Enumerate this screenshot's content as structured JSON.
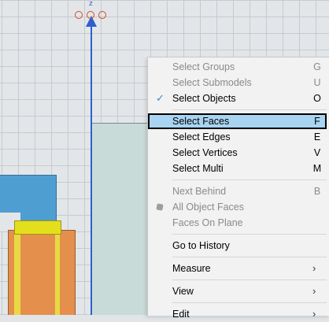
{
  "menu": {
    "groups": [
      [
        {
          "label": "Select Groups",
          "key": "G",
          "state": "disabled"
        },
        {
          "label": "Select Submodels",
          "key": "U",
          "state": "disabled"
        },
        {
          "label": "Select Objects",
          "key": "O",
          "state": "checked"
        }
      ],
      [
        {
          "label": "Select Faces",
          "key": "F",
          "state": "highlighted"
        },
        {
          "label": "Select Edges",
          "key": "E",
          "state": "normal"
        },
        {
          "label": "Select Vertices",
          "key": "V",
          "state": "normal"
        },
        {
          "label": "Select Multi",
          "key": "M",
          "state": "normal"
        }
      ],
      [
        {
          "label": "Next Behind",
          "key": "B",
          "state": "disabled"
        },
        {
          "label": "All Object Faces",
          "key": "",
          "state": "disabled-icon"
        },
        {
          "label": "Faces On Plane",
          "key": "",
          "state": "disabled"
        }
      ],
      [
        {
          "label": "Go to History",
          "key": "",
          "state": "normal"
        }
      ],
      [
        {
          "label": "Measure",
          "submenu": true
        }
      ],
      [
        {
          "label": "View",
          "submenu": true
        }
      ],
      [
        {
          "label": "Edit",
          "submenu": true
        }
      ]
    ]
  },
  "viewport": {
    "axis_label": "z",
    "axis_color": "#2d5fd0",
    "accent_check_color": "#3b87c9",
    "highlight_color": "#a8d4f2"
  },
  "icons": {
    "check": "checkmark-icon",
    "chevron": "chevron-right-icon",
    "faces": "cube-icon"
  }
}
